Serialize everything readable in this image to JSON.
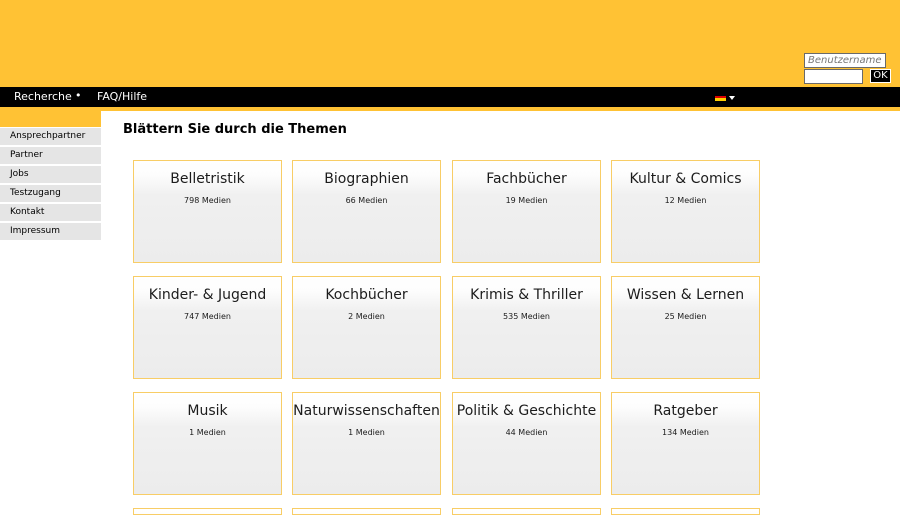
{
  "header": {
    "username_placeholder": "Benutzername",
    "password_value": "",
    "ok_label": "OK",
    "brand_color": "#ffc234"
  },
  "nav": {
    "items": [
      "Recherche",
      "FAQ/Hilfe"
    ],
    "separator": "•",
    "language_icon": "german-flag-icon"
  },
  "sidebar": {
    "items": [
      {
        "label": "Ansprechpartner"
      },
      {
        "label": "Partner"
      },
      {
        "label": "Jobs"
      },
      {
        "label": "Testzugang"
      },
      {
        "label": "Kontakt"
      },
      {
        "label": "Impressum"
      }
    ]
  },
  "main": {
    "title": "Blättern Sie durch die Themen",
    "categories": [
      {
        "name": "Belletristik",
        "count": "798 Medien"
      },
      {
        "name": "Biographien",
        "count": "66 Medien"
      },
      {
        "name": "Fachbücher",
        "count": "19 Medien"
      },
      {
        "name": "Kultur & Comics",
        "count": "12 Medien"
      },
      {
        "name": "Kinder- & Jugend",
        "count": "747 Medien"
      },
      {
        "name": "Kochbücher",
        "count": "2 Medien"
      },
      {
        "name": "Krimis & Thriller",
        "count": "535 Medien"
      },
      {
        "name": "Wissen & Lernen",
        "count": "25 Medien"
      },
      {
        "name": "Musik",
        "count": "1 Medien"
      },
      {
        "name": "Naturwissenschaften",
        "count": "1 Medien"
      },
      {
        "name": "Politik & Geschichte",
        "count": "44 Medien"
      },
      {
        "name": "Ratgeber",
        "count": "134 Medien"
      }
    ]
  }
}
